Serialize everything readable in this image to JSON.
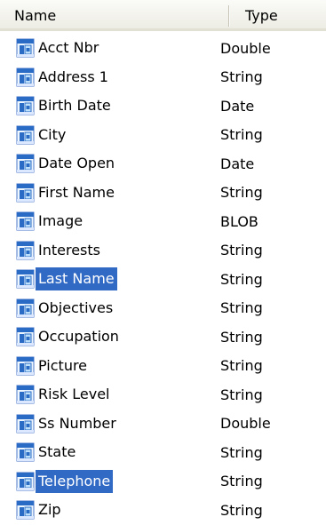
{
  "columns": {
    "name": "Name",
    "type": "Type"
  },
  "colors": {
    "selection": "#316ac5",
    "selected_text": "#ffffff",
    "icon_blue": "#2a6bc6",
    "icon_light": "#bfe0fb"
  },
  "fields": [
    {
      "name": "Acct Nbr",
      "type": "Double",
      "selected": false,
      "icon": "field-icon"
    },
    {
      "name": "Address 1",
      "type": "String",
      "selected": false,
      "icon": "field-icon"
    },
    {
      "name": "Birth Date",
      "type": "Date",
      "selected": false,
      "icon": "field-icon"
    },
    {
      "name": "City",
      "type": "String",
      "selected": false,
      "icon": "field-icon"
    },
    {
      "name": "Date Open",
      "type": "Date",
      "selected": false,
      "icon": "field-icon"
    },
    {
      "name": "First Name",
      "type": "String",
      "selected": false,
      "icon": "field-icon"
    },
    {
      "name": "Image",
      "type": "BLOB",
      "selected": false,
      "icon": "field-icon"
    },
    {
      "name": "Interests",
      "type": "String",
      "selected": false,
      "icon": "field-icon"
    },
    {
      "name": "Last Name",
      "type": "String",
      "selected": true,
      "icon": "field-icon"
    },
    {
      "name": "Objectives",
      "type": "String",
      "selected": false,
      "icon": "field-icon"
    },
    {
      "name": "Occupation",
      "type": "String",
      "selected": false,
      "icon": "field-icon"
    },
    {
      "name": "Picture",
      "type": "String",
      "selected": false,
      "icon": "field-icon"
    },
    {
      "name": "Risk Level",
      "type": "String",
      "selected": false,
      "icon": "field-icon"
    },
    {
      "name": "Ss Number",
      "type": "Double",
      "selected": false,
      "icon": "field-icon"
    },
    {
      "name": "State",
      "type": "String",
      "selected": false,
      "icon": "field-icon"
    },
    {
      "name": "Telephone",
      "type": "String",
      "selected": true,
      "icon": "field-icon"
    },
    {
      "name": "Zip",
      "type": "String",
      "selected": false,
      "icon": "field-icon"
    }
  ]
}
